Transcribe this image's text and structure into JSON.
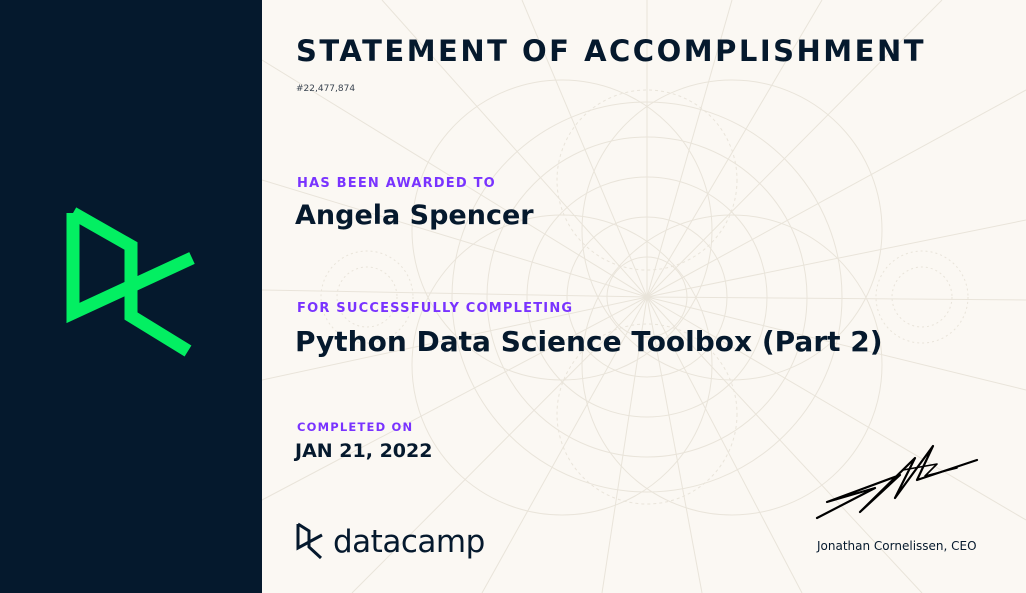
{
  "certificate": {
    "title": "STATEMENT OF ACCOMPLISHMENT",
    "number": "#22,477,874",
    "awarded_label": "HAS BEEN AWARDED TO",
    "recipient": "Angela Spencer",
    "completing_label": "FOR SUCCESSFULLY COMPLETING",
    "course": "Python Data Science Toolbox (Part 2)",
    "completed_label": "COMPLETED ON",
    "date": "JAN 21, 2022"
  },
  "brand": {
    "name": "datacamp",
    "logo_icon": "datacamp-logo-icon"
  },
  "signer": {
    "name": "Jonathan Cornelissen, CEO"
  },
  "colors": {
    "panel": "#05192d",
    "logo_green": "#03ef62",
    "accent_purple": "#7933ff",
    "background": "#fbf8f3",
    "text_dark": "#05192d"
  }
}
